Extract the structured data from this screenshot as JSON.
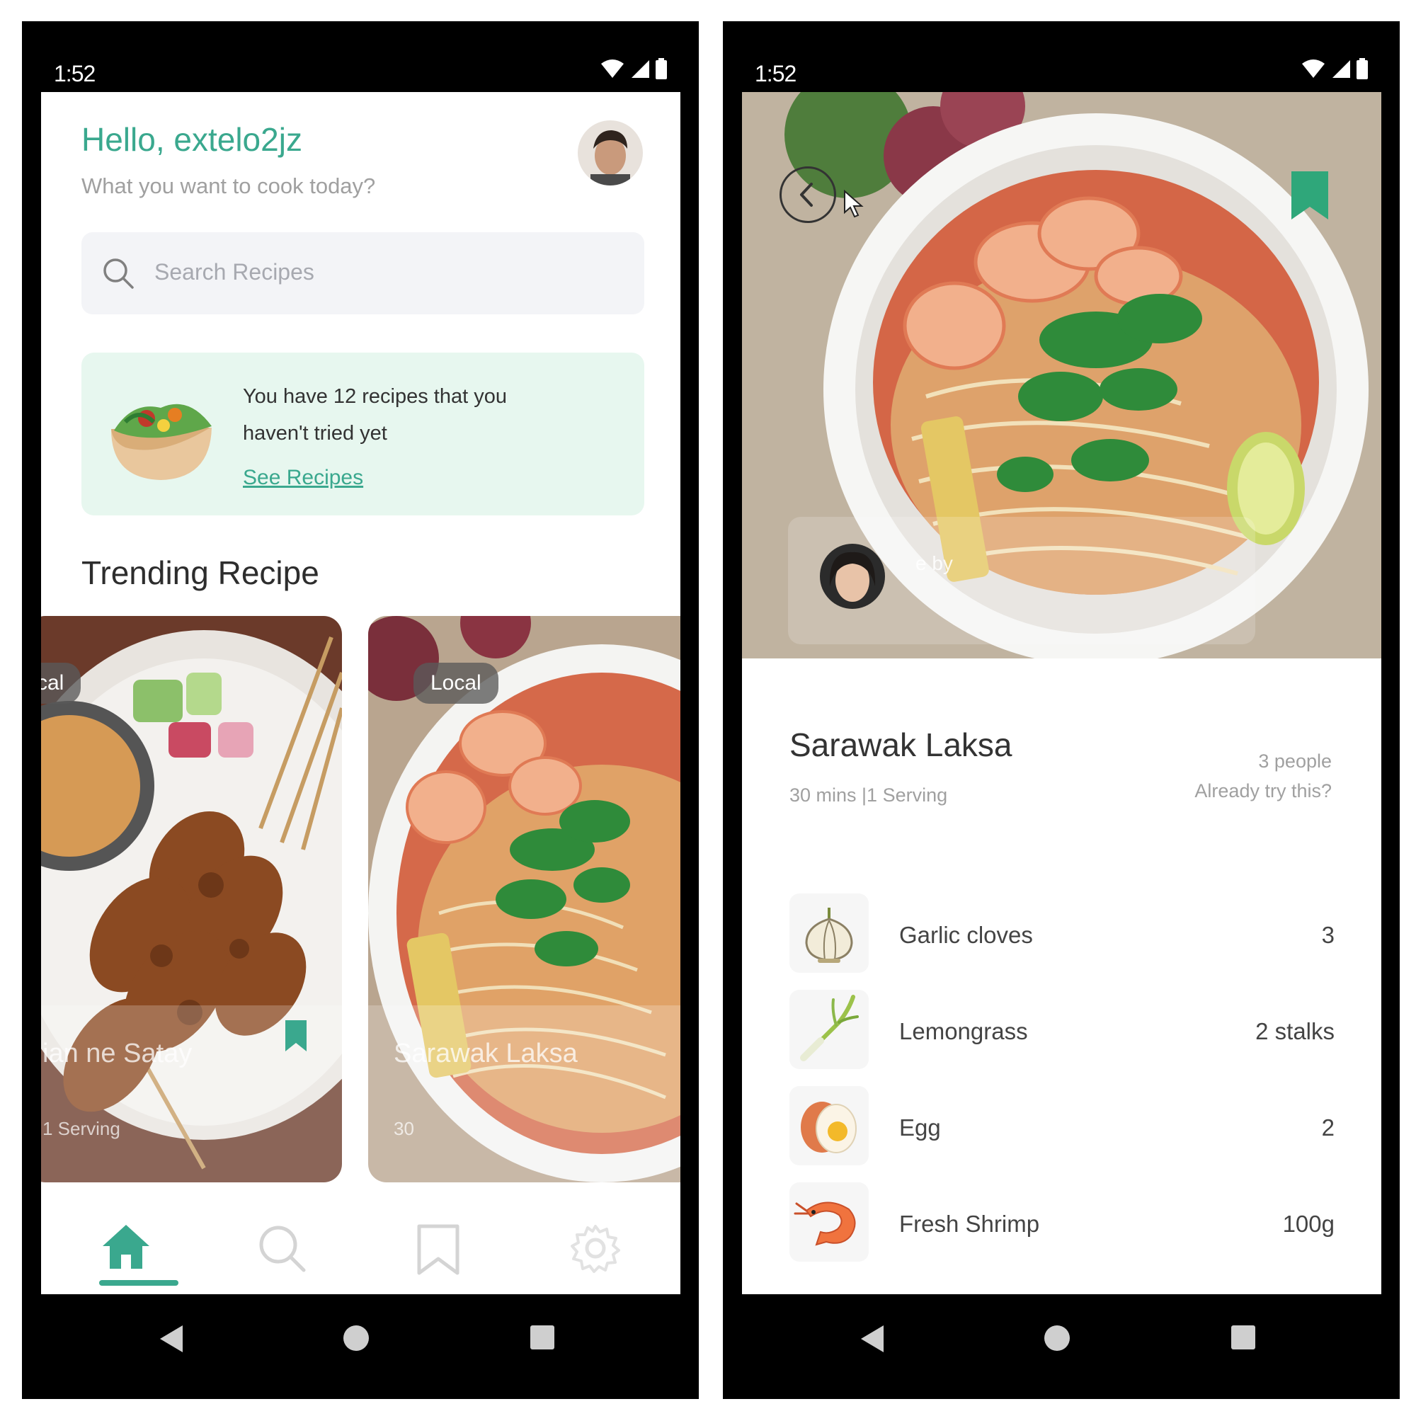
{
  "colors": {
    "accent": "#3aa88e",
    "promo_bg": "#e7f7ef",
    "search_bg": "#f3f4f7",
    "text_dark": "#333333",
    "text_muted": "#a0a0a0"
  },
  "left_phone": {
    "status_bar": {
      "time": "1:52"
    },
    "home": {
      "greeting": "Hello, extelo2jz",
      "subtitle": "What you want to cook today?",
      "search": {
        "placeholder": "Search Recipes"
      },
      "promo": {
        "text": "You have 12 recipes that you haven't tried yet",
        "link": "See Recipes"
      },
      "trending_title": "Trending Recipe",
      "cards": [
        {
          "badge": "cal",
          "title": "ian ne Satay",
          "meta": "1 Serving"
        },
        {
          "badge": "Local",
          "title": "Sarawak Laksa",
          "meta": "30"
        }
      ]
    },
    "bottom_nav": [
      {
        "name": "home",
        "icon": "home-icon",
        "active": true
      },
      {
        "name": "search",
        "icon": "search-icon",
        "active": false
      },
      {
        "name": "saved",
        "icon": "bookmark-icon",
        "active": false
      },
      {
        "name": "settings",
        "icon": "gear-icon",
        "active": false
      }
    ]
  },
  "right_phone": {
    "status_bar": {
      "time": "1:52"
    },
    "detail": {
      "author_label": "e by",
      "title": "Sarawak Laksa",
      "meta": "30 mins |1 Serving",
      "tried_count": "3 people",
      "tried_question": "Already try this?",
      "ingredients": [
        {
          "name": "Garlic cloves",
          "qty": "3",
          "icon": "garlic-icon"
        },
        {
          "name": "Lemongrass",
          "qty": "2 stalks",
          "icon": "lemongrass-icon"
        },
        {
          "name": "Egg",
          "qty": "2",
          "icon": "egg-icon"
        },
        {
          "name": "Fresh Shrimp",
          "qty": "100g",
          "icon": "shrimp-icon"
        }
      ]
    }
  }
}
